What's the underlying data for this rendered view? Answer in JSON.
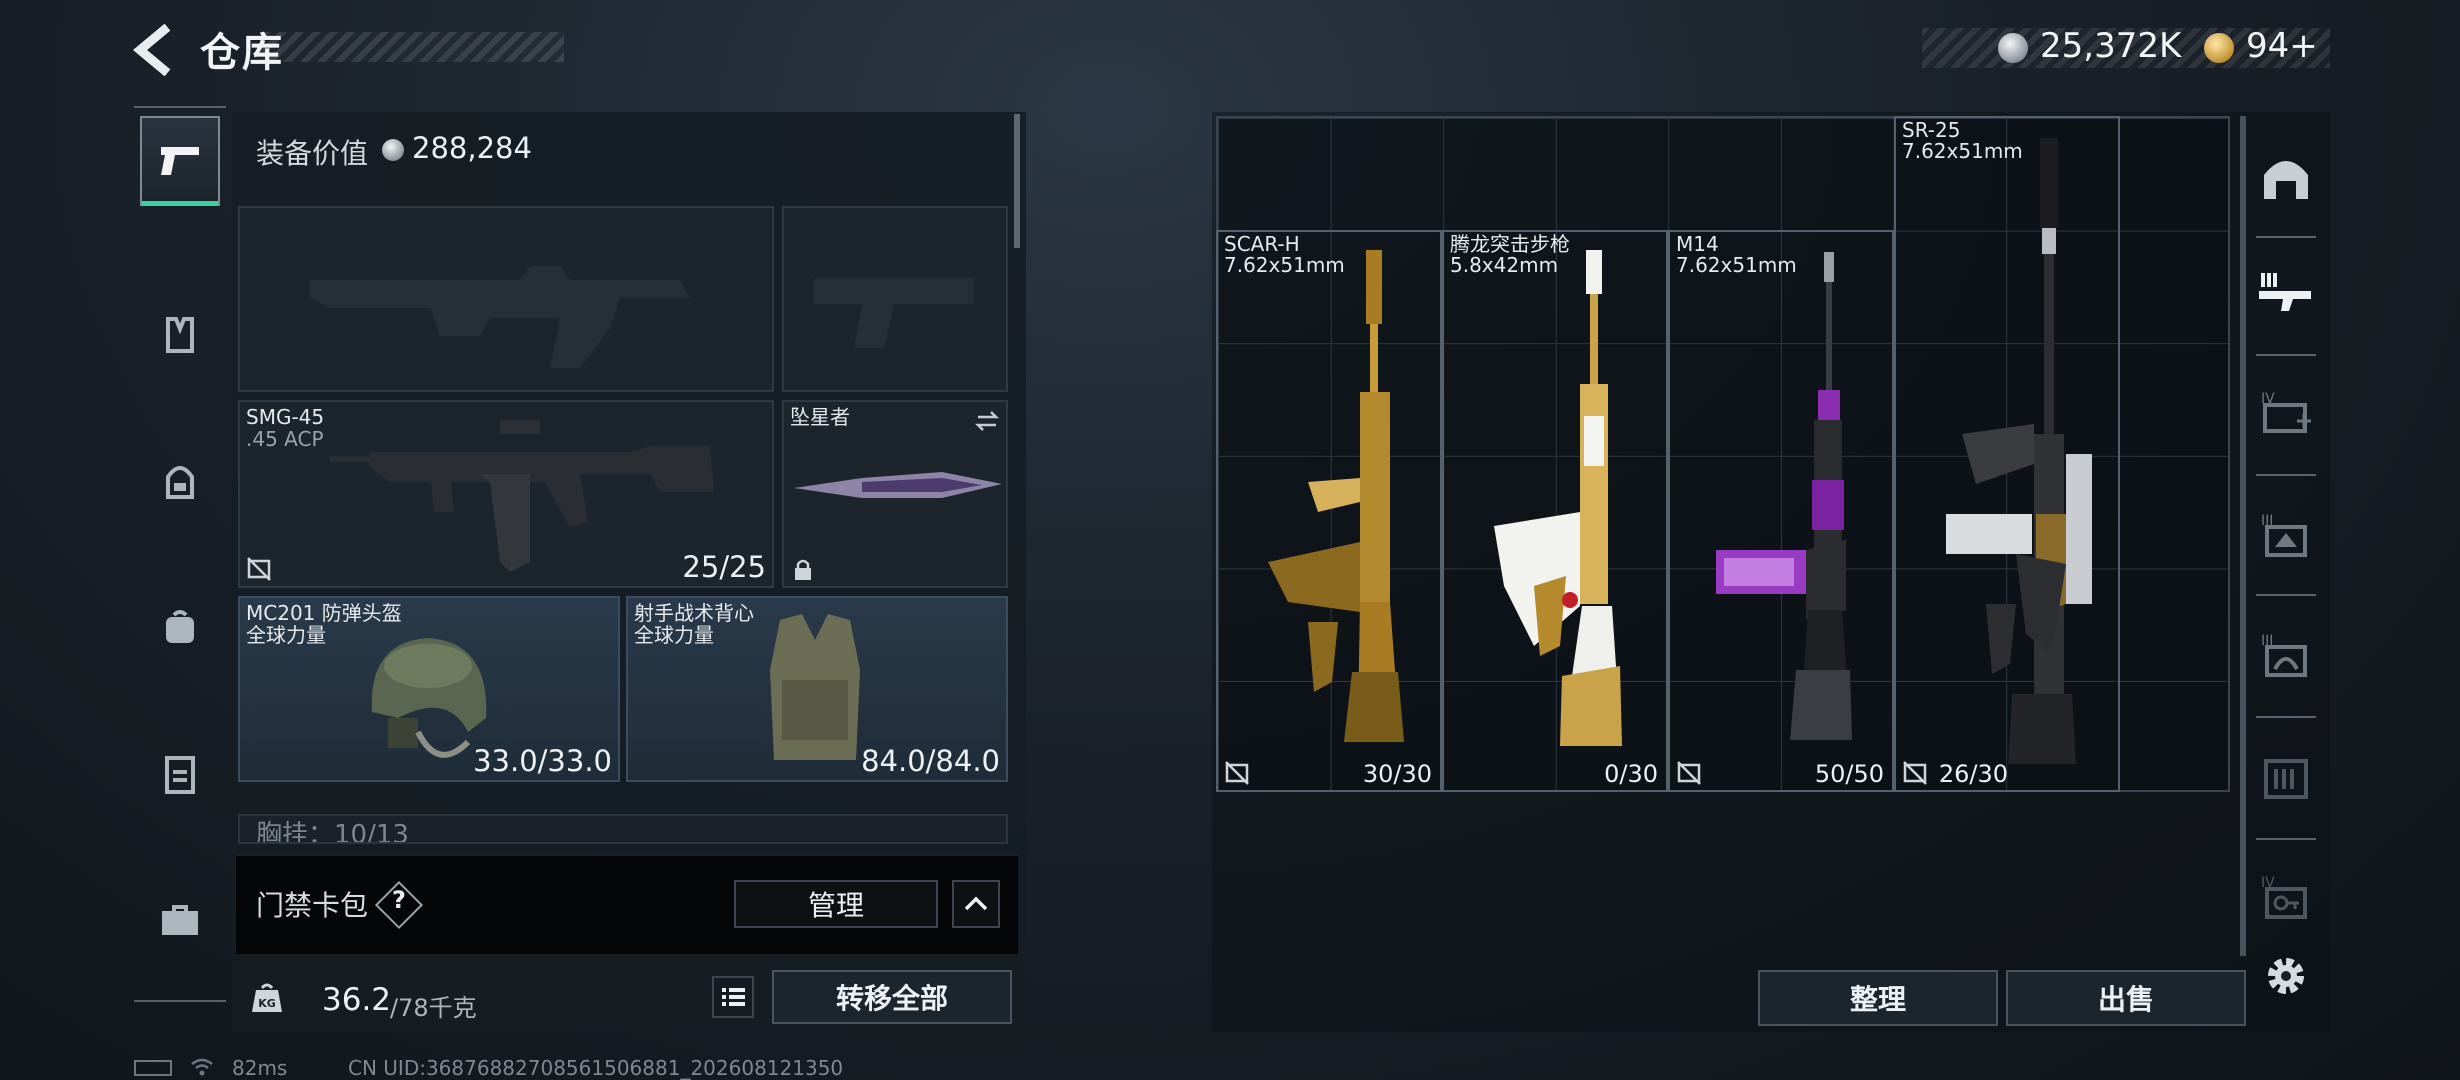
{
  "header": {
    "title": "仓库",
    "silver_amount": "25,372K",
    "gold_amount": "94+"
  },
  "sidebar": {
    "tabs": [
      {
        "icon": "pistol-icon",
        "active": true
      },
      {
        "icon": "rig-icon",
        "active": false
      },
      {
        "icon": "helmet-armor-icon",
        "active": false
      },
      {
        "icon": "backpack-icon",
        "active": false
      },
      {
        "icon": "chest-rig-icon",
        "active": false
      },
      {
        "icon": "briefcase-icon",
        "active": false
      }
    ]
  },
  "equipment": {
    "value_label": "装备价值",
    "value": "288,284",
    "primary_weapon": {
      "name": "SMG-45",
      "caliber": ".45 ACP",
      "ammo": "25/25"
    },
    "melee": {
      "name": "坠星者"
    },
    "helmet": {
      "name": "MC201 防弹头盔",
      "brand": "全球力量",
      "durability": "33.0/33.0"
    },
    "armor": {
      "name": "射手战术背心",
      "brand": "全球力量",
      "durability": "84.0/84.0"
    },
    "chest_rig_label": "胸挂：10/13"
  },
  "keycard": {
    "label": "门禁卡包",
    "help": "?",
    "manage_label": "管理"
  },
  "footer": {
    "weight_current": "36.2",
    "weight_max": "/78千克",
    "transfer_all_label": "转移全部"
  },
  "status": {
    "ping": "82ms",
    "uid": "CN UID:3687688270856150688​1_202608121350"
  },
  "stash": {
    "items": [
      {
        "name": "SCAR-H",
        "caliber": "7.62x51mm",
        "ammo": "30/30",
        "finish": "gold"
      },
      {
        "name": "腾龙突击步枪",
        "caliber": "5.8x42mm",
        "ammo": "0/30",
        "finish": "white-gold"
      },
      {
        "name": "M14",
        "caliber": "7.62x51mm",
        "ammo": "50/50",
        "finish": "purple"
      },
      {
        "name": "SR-25",
        "caliber": "7.62x51mm",
        "ammo": "26/30",
        "finish": "black"
      }
    ],
    "sort_label": "整理",
    "sell_label": "出售"
  },
  "colors": {
    "accent_green": "#3ad29f",
    "panel_bg": "#161d24",
    "gold": "#c19435"
  }
}
